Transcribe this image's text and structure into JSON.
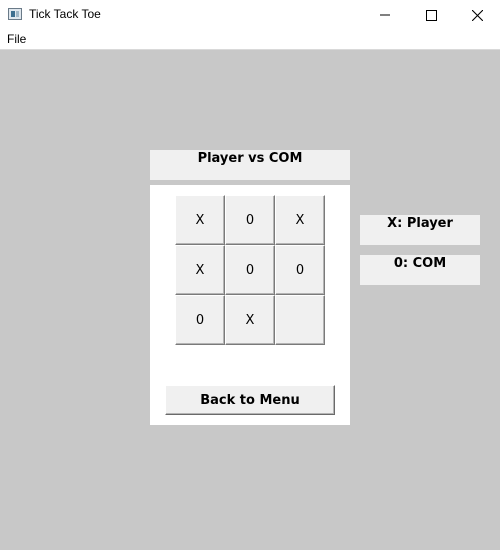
{
  "window": {
    "title": "Tick Tack Toe",
    "icon": "app-window-icon",
    "controls": [
      "minimize-icon",
      "maximize-icon",
      "close-icon"
    ]
  },
  "menu": {
    "file_label": "File"
  },
  "game": {
    "mode_label": "Player vs COM",
    "board": [
      "X",
      "0",
      "X",
      "X",
      "0",
      "0",
      "0",
      "X",
      ""
    ],
    "back_button_label": "Back to Menu"
  },
  "legend": {
    "x_label": "X: Player",
    "o_label": "0: COM"
  },
  "colors": {
    "background": "#c8c8c8",
    "panel": "#ffffff",
    "control_face": "#f0f0f0"
  }
}
